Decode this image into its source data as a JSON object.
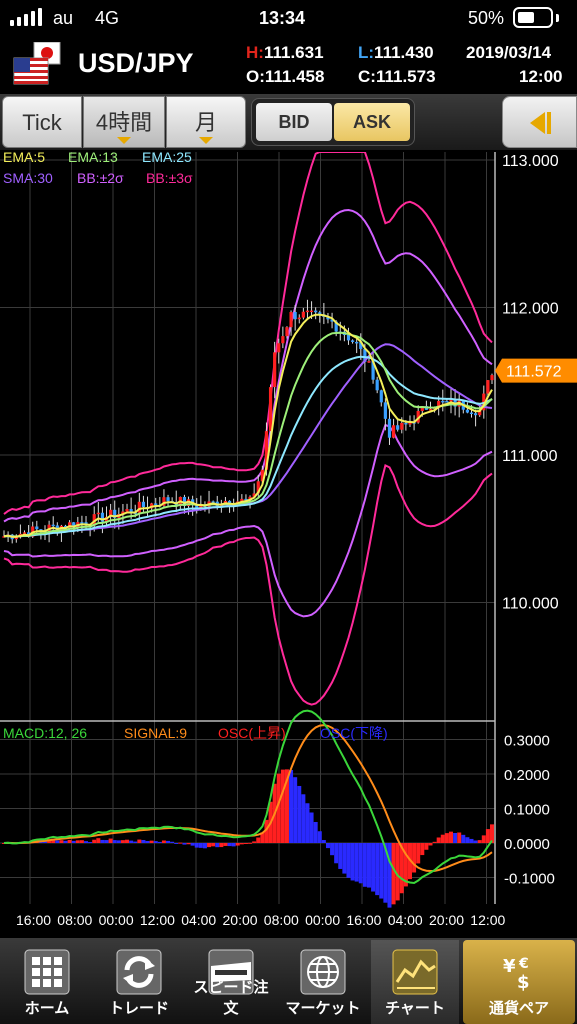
{
  "status": {
    "carrier": "au",
    "network": "4G",
    "time": "13:34",
    "battery": "50%"
  },
  "header": {
    "pair": "USD/JPY",
    "high_label": "H:",
    "high": "111.631",
    "low_label": "L:",
    "low": "111.430",
    "open_label": "O:",
    "open": "111.458",
    "close_label": "C:",
    "close": "111.573",
    "date": "2019/03/14",
    "time": "12:00",
    "flag_icons": [
      "jp-flag-icon",
      "us-flag-icon"
    ]
  },
  "tabs": {
    "tick": "Tick",
    "period": "4時間",
    "month": "月",
    "bid": "BID",
    "ask": "ASK"
  },
  "indicators_top": [
    {
      "label": "EMA:5",
      "color": "#f4ef5a"
    },
    {
      "label": "EMA:13",
      "color": "#9ef07a"
    },
    {
      "label": "EMA:25",
      "color": "#8ee8ff"
    },
    {
      "label": "SMA:30",
      "color": "#a060ff"
    },
    {
      "label": "BB:±2σ",
      "color": "#d060ff"
    },
    {
      "label": "BB:±3σ",
      "color": "#ff2a9a"
    }
  ],
  "indicators_bottom": [
    {
      "label": "MACD:12, 26",
      "color": "#3ad63a"
    },
    {
      "label": "SIGNAL:9",
      "color": "#ff8c1a"
    },
    {
      "label": "OSC(上昇)",
      "color": "#ff2020"
    },
    {
      "label": "OSC(下降)",
      "color": "#2a2aff"
    }
  ],
  "price_axis": [
    "113.000",
    "112.000",
    "111.000",
    "110.000"
  ],
  "current_price": "111.572",
  "macd_axis": [
    "0.3000",
    "0.2000",
    "0.1000",
    "0.0000",
    "-0.1000"
  ],
  "time_axis": [
    "16:00",
    "08:00",
    "00:00",
    "12:00",
    "04:00",
    "20:00",
    "08:00",
    "00:00",
    "16:00",
    "04:00",
    "20:00",
    "12:00"
  ],
  "nav": [
    {
      "label": "ホーム",
      "icon": "grid-icon"
    },
    {
      "label": "トレード",
      "icon": "refresh-arrows-icon"
    },
    {
      "label": "スピード注文",
      "icon": "speed-icon"
    },
    {
      "label": "マーケット",
      "icon": "globe-icon"
    },
    {
      "label": "チャート",
      "icon": "chart-icon"
    },
    {
      "label": "通貨ペア",
      "icon": "currency-icon"
    }
  ],
  "colors": {
    "accent": "#e6a800",
    "price_tag": "#ff8c00",
    "grid": "#3a3a3a"
  }
}
